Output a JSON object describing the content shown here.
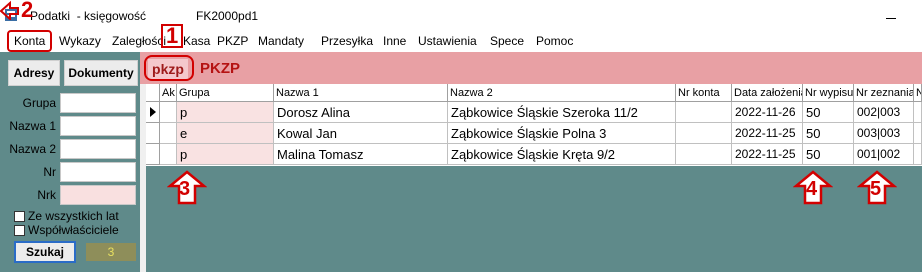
{
  "window": {
    "title": "Podatki  - księgowość",
    "subtitle": "FK2000pd1"
  },
  "menu": [
    {
      "label": "Konta"
    },
    {
      "label": "Wykazy"
    },
    {
      "label": "Zaległości"
    },
    {
      "label": "Kasa"
    },
    {
      "label": "PKZP"
    },
    {
      "label": "Mandaty"
    },
    {
      "label": "Przesyłka"
    },
    {
      "label": "Inne"
    },
    {
      "label": "Ustawienia"
    },
    {
      "label": "Spece"
    },
    {
      "label": "Pomoc"
    }
  ],
  "left_panel": {
    "tabs": [
      "Adresy",
      "Dokumenty"
    ],
    "fields": [
      {
        "label": "Grupa",
        "value": ""
      },
      {
        "label": "Nazwa 1",
        "value": ""
      },
      {
        "label": "Nazwa 2",
        "value": ""
      },
      {
        "label": "Nr",
        "value": ""
      },
      {
        "label": "Nrk",
        "value": ""
      }
    ],
    "checkboxes": [
      {
        "label": "Ze wszystkich lat",
        "checked": false
      },
      {
        "label": "Współwłaściciele",
        "checked": false
      }
    ],
    "search_label": "Szukaj",
    "result_count": "3"
  },
  "module": {
    "code": "pkzp",
    "title": "PKZP"
  },
  "grid": {
    "columns": [
      "Ak",
      "Grupa",
      "Nazwa 1",
      "Nazwa 2",
      "Nr konta",
      "Data założenia",
      "Nr wypisu",
      "Nr zeznania",
      "N"
    ],
    "rows": [
      {
        "selected": true,
        "cells": [
          "",
          "p",
          "Dorosz Alina",
          "Ząbkowice Śląskie  Szeroka 11/2",
          "",
          "2022-11-26",
          "50",
          "002|003"
        ]
      },
      {
        "selected": false,
        "cells": [
          "",
          "e",
          "Kowal Jan",
          "Ząbkowice Śląskie  Polna 3",
          "",
          "2022-11-25",
          "50",
          "003|003"
        ]
      },
      {
        "selected": false,
        "cells": [
          "",
          "p",
          "Malina Tomasz",
          "Ząbkowice Śląskie  Kręta 9/2",
          "",
          "2022-11-25",
          "50",
          "001|002"
        ]
      }
    ]
  },
  "annotations": [
    "1",
    "2",
    "3",
    "4",
    "5"
  ],
  "colors": {
    "panel_teal": "#5f8a8a",
    "module_bar": "#e8a0a4",
    "annotation_red": "#d20000",
    "group_cell_pink": "#f9e2e2"
  }
}
